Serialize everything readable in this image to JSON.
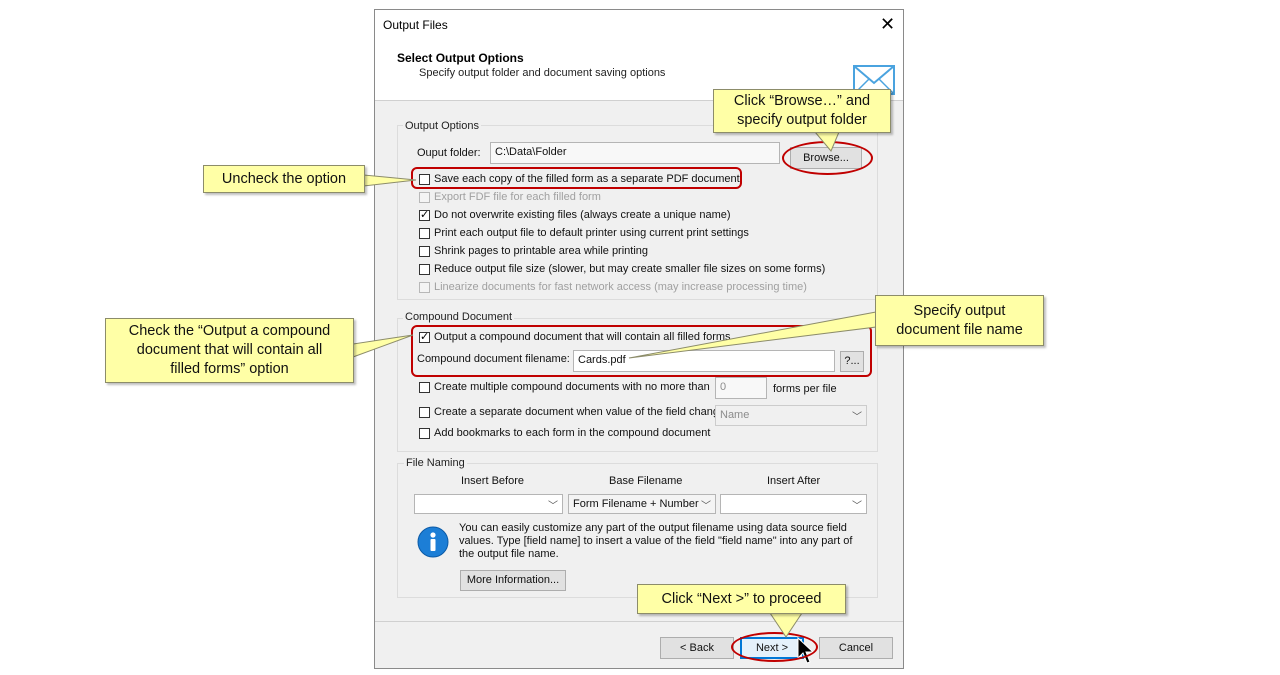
{
  "window": {
    "title": "Output Files",
    "close_glyph": "✕"
  },
  "header": {
    "title": "Select Output Options",
    "subtitle": "Specify output folder and document saving options",
    "icon": "envelope-icon"
  },
  "output_options": {
    "legend": "Output Options",
    "folder_label": "Ouput folder:",
    "folder_value": "C:\\Data\\Folder",
    "browse_label": "Browse...",
    "checkboxes": [
      {
        "label": "Save each copy of the filled form as a separate PDF document",
        "checked": false,
        "enabled": true
      },
      {
        "label": "Export FDF file for each filled form",
        "checked": false,
        "enabled": false
      },
      {
        "label": "Do not overwrite existing files (always create a unique name)",
        "checked": true,
        "enabled": true
      },
      {
        "label": "Print each output file to default printer using current print settings",
        "checked": false,
        "enabled": true
      },
      {
        "label": "Shrink pages to printable area while printing",
        "checked": false,
        "enabled": true
      },
      {
        "label": "Reduce output file size  (slower, but may create smaller file sizes on some forms)",
        "checked": false,
        "enabled": true
      },
      {
        "label": "Linearize documents for fast network access (may increase processing time)",
        "checked": false,
        "enabled": false
      }
    ]
  },
  "compound": {
    "legend": "Compound Document",
    "output_compound_label": "Output a compound document that will contain all filled forms",
    "filename_label": "Compound document filename:",
    "filename_value": "Cards.pdf",
    "pick_label": "?...",
    "multiple_label": "Create multiple compound documents with no more than",
    "multiple_value": "0",
    "per_file_label": "forms per file",
    "separate_label": "Create a separate document when value of the field chang",
    "separate_field": "Name",
    "bookmarks_label": "Add bookmarks to each form in the compound document"
  },
  "file_naming": {
    "legend": "File Naming",
    "insert_before_label": "Insert Before",
    "base_label": "Base Filename",
    "insert_after_label": "Insert After",
    "insert_before_value": "",
    "base_value": "Form Filename + Number",
    "insert_after_value": "",
    "info_text": "You can easily customize any part of the output filename using data source field values. Type [field name] to insert a value of the field \"field name\" into any part of the output file name.",
    "more_info_label": "More Information..."
  },
  "footer": {
    "back_label": "< Back",
    "next_label": "Next >",
    "cancel_label": "Cancel"
  },
  "callouts": {
    "browse": "Click “Browse…” and\nspecify output folder",
    "uncheck": "Uncheck the option",
    "compound_check": "Check the “Output a compound\ndocument that will contain all\nfilled forms” option",
    "filename": "Specify output\ndocument file name",
    "next": "Click “Next >” to proceed"
  },
  "colors": {
    "callout_bg": "#ffffa6",
    "highlight_red": "#c00000",
    "focus_blue": "#0078d7"
  }
}
